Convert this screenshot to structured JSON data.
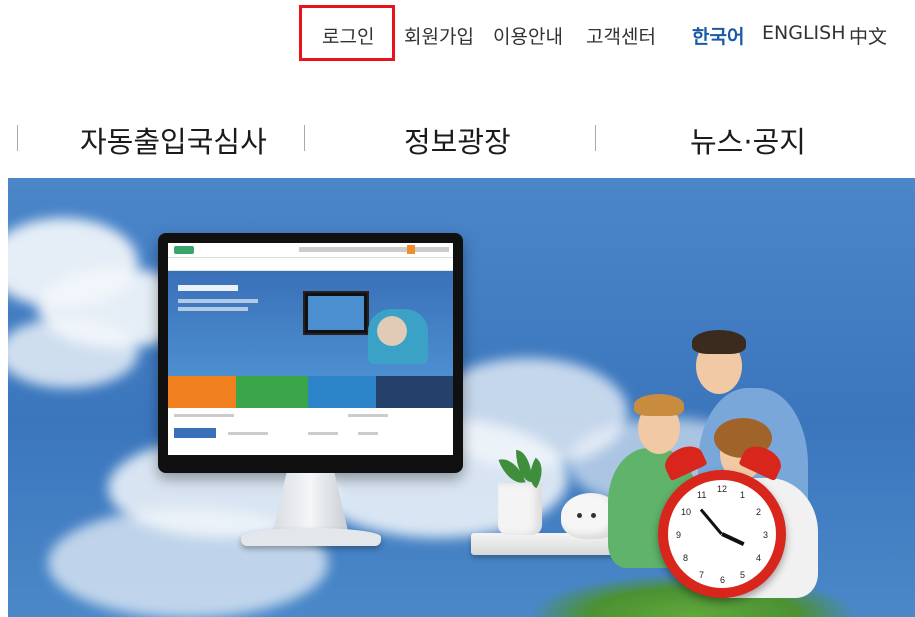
{
  "utility_nav": {
    "login": "로그인",
    "signup": "회원가입",
    "guide": "이용안내",
    "support": "고객센터",
    "lang_ko": "한국어",
    "lang_en": "ENGLISH",
    "lang_zh": "中文"
  },
  "main_nav": {
    "items": [
      "자동출입국심사",
      "정보광장",
      "뉴스·공지"
    ]
  },
  "colors": {
    "highlight": "#e8141b",
    "active_language": "#1a5aa6",
    "hero_background": "#4680c4"
  }
}
